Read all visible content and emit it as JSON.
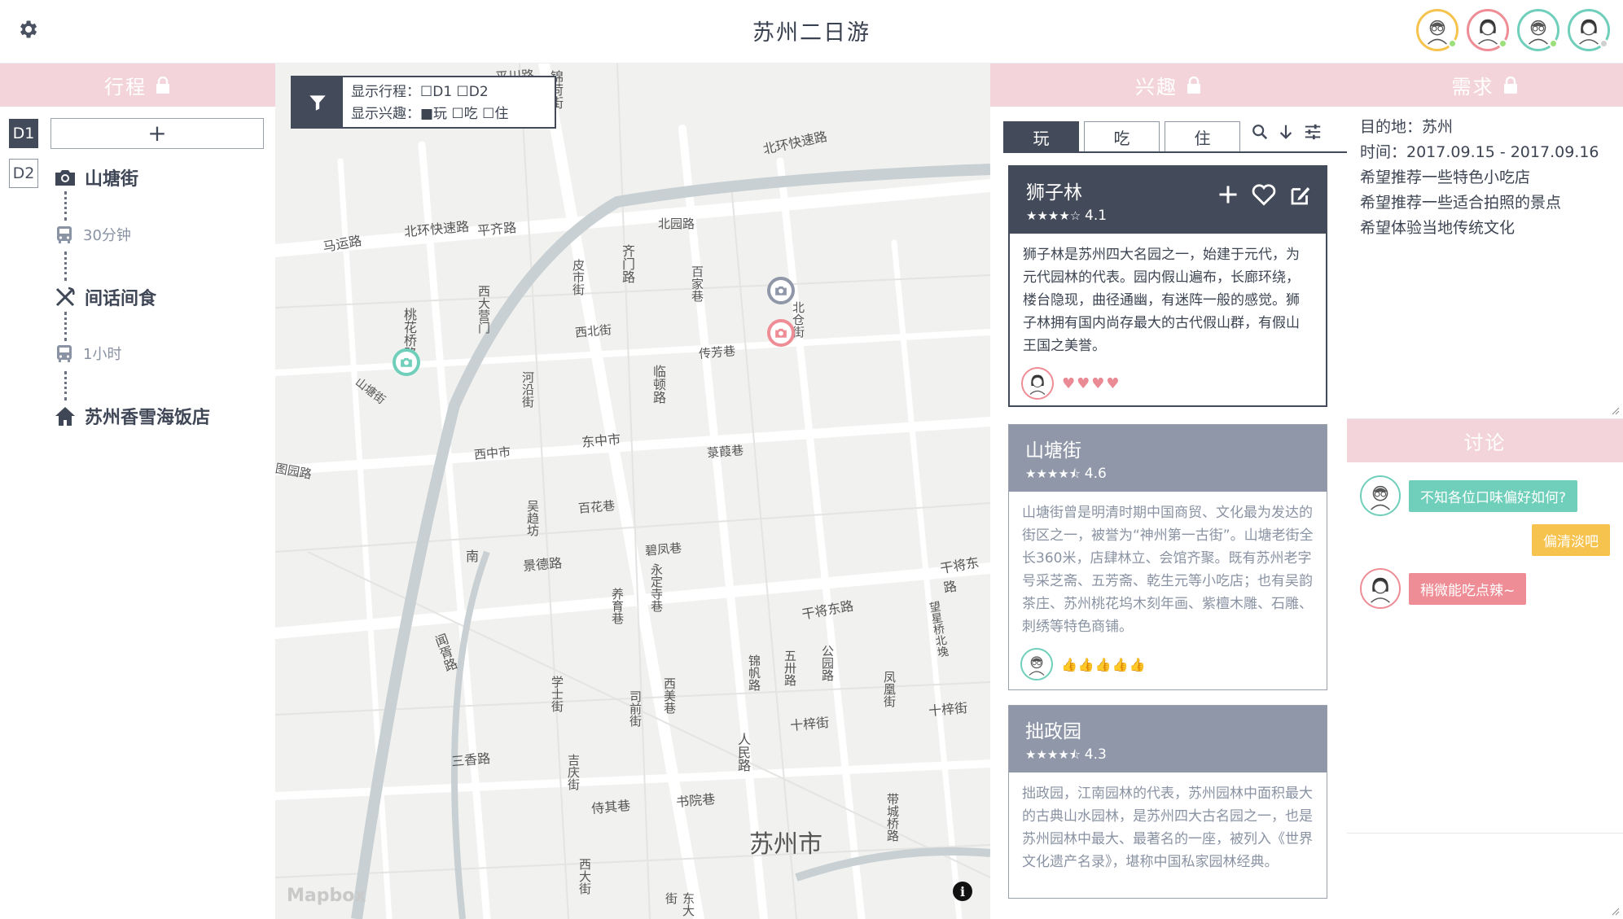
{
  "app": {
    "title": "苏州二日游"
  },
  "users": [
    {
      "icon": "man-glasses-avatar-icon",
      "ring": "#f6c34e",
      "status": "#9be07a"
    },
    {
      "icon": "woman-avatar-icon",
      "ring": "#ee8d95",
      "status": "#9be07a"
    },
    {
      "icon": "man-glasses-avatar-icon",
      "ring": "#6fcfba",
      "status": "#9be07a"
    },
    {
      "icon": "woman-avatar-icon",
      "ring": "#6fcfba",
      "status": "#d0d0d0"
    }
  ],
  "panels": {
    "itinerary": "行程",
    "interests": "兴趣",
    "needs": "需求",
    "discussion": "讨论"
  },
  "itinerary": {
    "days": [
      "D1",
      "D2"
    ],
    "add_label": "+",
    "stops": [
      {
        "icon": "camera-icon",
        "name": "山塘街"
      },
      {
        "icon": "food-icon",
        "name": "间话间食"
      },
      {
        "icon": "home-icon",
        "name": "苏州香雪海饭店"
      }
    ],
    "transfers": [
      {
        "icon": "bus-icon",
        "duration": "30分钟"
      },
      {
        "icon": "bus-icon",
        "duration": "1小时"
      }
    ]
  },
  "map": {
    "filter_line1": "显示行程：☐D1 ☐D2",
    "filter_line2": "显示兴趣：■玩 ☐吃 ☐住",
    "attribution": "Mapbox",
    "info": "i",
    "labels": [
      "平川路",
      "锦荷街",
      "北环快速路",
      "北环快速路",
      "平齐路",
      "马运路",
      "北园路",
      "齐门路",
      "皮市街",
      "百家巷",
      "西大营门",
      "桃花桥路",
      "西北街",
      "北仓街",
      "河沿街",
      "传芳巷",
      "临顿路",
      "山塘街",
      "东中市",
      "西中市",
      "菉葭巷",
      "百花巷",
      "吴趋坊",
      "景德路",
      "碧凤巷",
      "干将东路",
      "永定寺巷",
      "养育巷",
      "干将东路",
      "南",
      "闻胥路",
      "望星桥北堍",
      "锦帆路",
      "五卅路",
      "公园路",
      "学士街",
      "司前街",
      "西美巷",
      "凤凰街",
      "十梓街",
      "十梓街",
      "三香路",
      "吉庆街",
      "人民路",
      "侍其巷",
      "书院巷",
      "带城桥路",
      "西大街",
      "东大街",
      "苏州市",
      "图园路"
    ]
  },
  "interests": {
    "tabs": [
      "玩",
      "吃",
      "住"
    ],
    "cards": [
      {
        "name": "狮子林",
        "stars": "★★★★☆",
        "rating": "4.1",
        "desc": "狮子林是苏州四大名园之一，始建于元代，为元代园林的代表。园内假山遍布，长廊环绕，楼台隐现，曲径通幽，有迷阵一般的感觉。狮子林拥有国内尚存最大的古代假山群，有假山王国之美誉。",
        "reaction": "♥♥♥♥"
      },
      {
        "name": "山塘街",
        "stars": "★★★★⯪",
        "rating": "4.6",
        "desc": "山塘街曾是明清时期中国商贸、文化最为发达的街区之一，被誉为“神州第一古街”。山塘老街全长360米，店肆林立、会馆齐聚。既有苏州老字号采芝斋、五芳斋、乾生元等小吃店；也有吴韵茶庄、苏州桃花坞木刻年画、紫檀木雕、石雕、刺绣等特色商铺。",
        "reaction": "👍👍👍👍👍"
      },
      {
        "name": "拙政园",
        "stars": "★★★★⯪",
        "rating": "4.3",
        "desc": "拙政园，江南园林的代表，苏州园林中面积最大的古典山水园林，是苏州四大古名园之一，也是苏州园林中最大、最著名的一座，被列入《世界文化遗产名录》，堪称中国私家园林经典。"
      }
    ]
  },
  "needs": {
    "lines": [
      "目的地：苏州",
      "时间：2017.09.15 - 2017.09.16",
      "希望推荐一些特色小吃店",
      "希望推荐一些适合拍照的景点",
      "希望体验当地传统文化"
    ]
  },
  "discussion": {
    "messages": [
      {
        "text": "不知各位口味偏好如何?",
        "color": "teal"
      },
      {
        "text": "偏清淡吧",
        "color": "orange"
      },
      {
        "text": "稍微能吃点辣~",
        "color": "pink"
      }
    ]
  },
  "colors": {
    "header_pink": "#f3d4da",
    "dark": "#434a5a",
    "teal": "#6fcfba",
    "orange": "#f6c34e",
    "pink": "#ee8d95"
  }
}
